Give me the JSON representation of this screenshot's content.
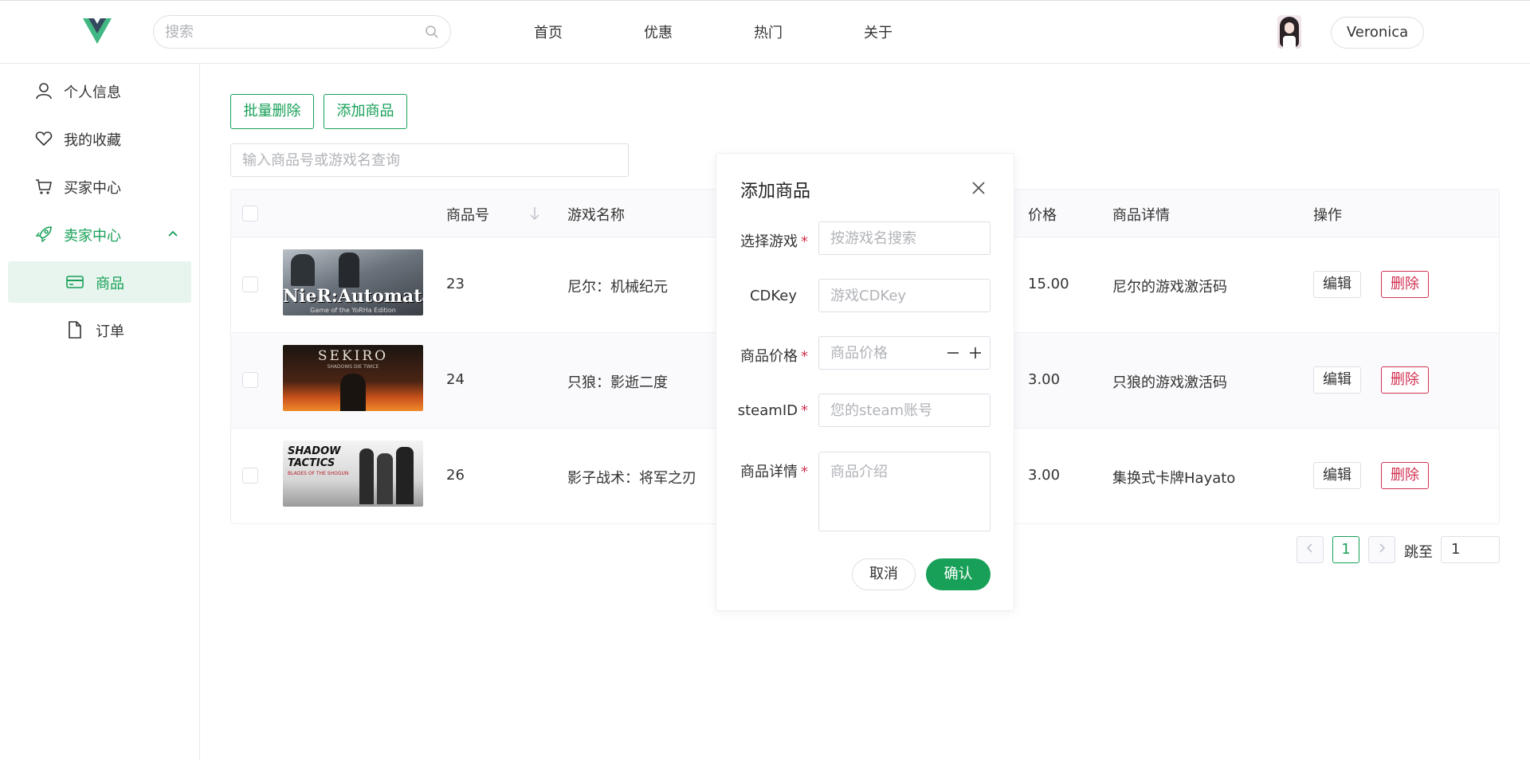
{
  "header": {
    "search_placeholder": "搜索",
    "nav": [
      "首页",
      "优惠",
      "热门",
      "关于"
    ],
    "user_name": "Veronica"
  },
  "sidebar": {
    "items": [
      {
        "label": "个人信息",
        "icon": "user-icon"
      },
      {
        "label": "我的收藏",
        "icon": "heart-icon"
      },
      {
        "label": "买家中心",
        "icon": "cart-icon"
      },
      {
        "label": "卖家中心",
        "icon": "rocket-icon",
        "expanded": true
      },
      {
        "label": "商品",
        "icon": "card-icon",
        "selected": true
      },
      {
        "label": "订单",
        "icon": "document-icon"
      }
    ]
  },
  "toolbar": {
    "batch_delete": "批量删除",
    "add_product": "添加商品",
    "query_placeholder": "输入商品号或游戏名查询"
  },
  "table": {
    "headers": {
      "id": "商品号",
      "game": "游戏名称",
      "price": "价格",
      "detail": "商品详情",
      "actions": "操作"
    },
    "rows": [
      {
        "id": "23",
        "game": "尼尔：机械纪元",
        "price": "15.00",
        "detail": "尼尔的游戏激活码",
        "thumb_text": "NieR:Automata",
        "thumb_sub": "Game of the YoRHa Edition"
      },
      {
        "id": "24",
        "game": "只狼：影逝二度",
        "price": "3.00",
        "detail": "只狼的游戏激活码",
        "thumb_text": "SEKIRO",
        "thumb_sub": "SHADOWS DIE TWICE"
      },
      {
        "id": "26",
        "game": "影子战术：将军之刃",
        "price": "3.00",
        "detail": "集换式卡牌Hayato",
        "thumb_text": "SHADOW TACTICS",
        "thumb_sub": "BLADES OF THE SHOGUN"
      }
    ],
    "edit_label": "编辑",
    "delete_label": "删除"
  },
  "pagination": {
    "current_page": "1",
    "jump_label": "跳至",
    "jump_value": "1"
  },
  "modal": {
    "title": "添加商品",
    "fields": [
      {
        "label": "选择游戏",
        "required": true,
        "placeholder": "按游戏名搜索"
      },
      {
        "label": "CDKey",
        "required": false,
        "placeholder": "游戏CDKey"
      },
      {
        "label": "商品价格",
        "required": true,
        "placeholder": "商品价格"
      },
      {
        "label": "steamID",
        "required": true,
        "placeholder": "您的steam账号"
      },
      {
        "label": "商品详情",
        "required": true,
        "placeholder": "商品介绍"
      }
    ],
    "cancel": "取消",
    "confirm": "确认",
    "required_mark": "*"
  },
  "colors": {
    "primary": "#18a058",
    "danger": "#d03050",
    "border": "#dcdfe6"
  }
}
